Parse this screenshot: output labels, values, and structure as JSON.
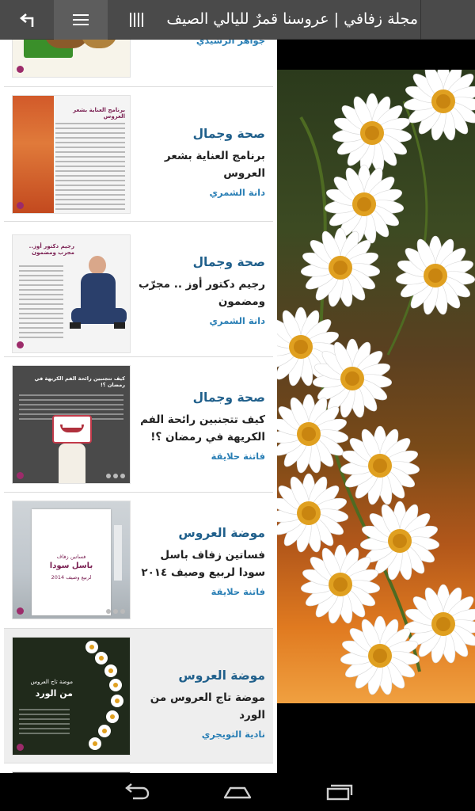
{
  "topbar": {
    "title": "مجلة زفافي | عروسنا قمرٌ لليالي الصيف"
  },
  "articles": [
    {
      "category": "",
      "headline": "",
      "author": "جواهر الرشيدي",
      "thumb_title": ""
    },
    {
      "category": "صحة وجمال",
      "headline": "برنامج العناية بشعر العروس",
      "author": "دانة الشمري",
      "thumb_title": "برنامج العناية بشعر العروس"
    },
    {
      "category": "صحة وجمال",
      "headline": "رجيم دكتور أوز .. مجرّب ومضمون",
      "author": "دانة الشمري",
      "thumb_title": "رجيم دكتور أوز.. مجرب ومضمون"
    },
    {
      "category": "صحة وجمال",
      "headline": "كيف تتجنبين رائحة الفم الكريهة في رمضان ؟!",
      "author": "فاتنة حلايقة",
      "thumb_title": "كيف تتجنبين رائحة الفم الكريهة في رمضان ؟!"
    },
    {
      "category": "موضة العروس",
      "headline": "فساتين زفاف باسل سودا لربيع وصيف ٢٠١٤",
      "author": "فاتنة حلايقة",
      "thumb_title": "فساتين زفاف باسل سودا لربيع وصيف 2014",
      "thumb_sub1": "فساتين زفاف",
      "thumb_sub2": "باسل سودا",
      "thumb_sub3": "لربيع وصيف 2014"
    },
    {
      "category": "موضة العروس",
      "headline": "موضة تاج العروس من الورد",
      "author": "نادية التويجري",
      "thumb_title": "موضة تاج العروس من الورد",
      "thumb_sub1": "موضة تاج العروس",
      "thumb_sub2": "من الورد"
    }
  ],
  "icons": {
    "back": "back-arrow-icon",
    "menu": "hamburger-menu-icon",
    "toc": "vertical-bars-icon",
    "nav_back": "nav-back-icon",
    "nav_home": "nav-home-icon",
    "nav_recents": "nav-recents-icon"
  },
  "colors": {
    "topbar": "#4a4a4a",
    "category": "#1f5f8b",
    "author": "#2a7fb5",
    "accent_pin": "#9c2b6a"
  }
}
